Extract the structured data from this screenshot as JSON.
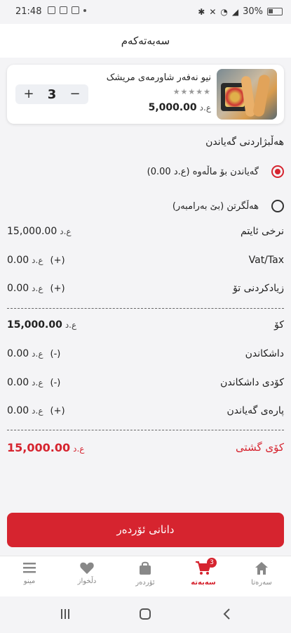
{
  "status_bar": {
    "time": "21:48",
    "battery": "30%"
  },
  "header": {
    "title": "سەبەتەکەم"
  },
  "cart_item": {
    "name": "نیو نەفەر شاورمەی مریشک",
    "stars": "★★★★★",
    "price": "5,000.00",
    "currency": "ع.د",
    "quantity": "3",
    "plus": "+",
    "minus": "−"
  },
  "delivery": {
    "title": "هەڵبژاردنی گەیاندن",
    "option_home": "گەیاندن بۆ ماڵەوە (ع.د 0.00)",
    "option_pickup": "هەڵگرتن (بێ بەرامبەر)",
    "selected": "home"
  },
  "summary": {
    "currency": "ع.د",
    "item_price": {
      "label": "نرخی ئایتم",
      "value": "15,000.00"
    },
    "vat": {
      "label": "Vat/Tax",
      "value": "0.00",
      "sign": "(+)"
    },
    "tip": {
      "label": "زیادکردنی تۆ",
      "value": "0.00",
      "sign": "(+)"
    },
    "subtotal": {
      "label": "کۆ",
      "value": "15,000.00"
    },
    "discount": {
      "label": "داشکاندن",
      "value": "0.00",
      "sign": "(-)"
    },
    "coupon": {
      "label": "کۆدی داشکاندن",
      "value": "0.00",
      "sign": "(-)"
    },
    "delivery_fee": {
      "label": "پارەی گەیاندن",
      "value": "0.00",
      "sign": "(+)"
    },
    "total": {
      "label": "کۆی گشتی",
      "value": "15,000.00"
    }
  },
  "cta": {
    "label": "دانانی ئۆردەر"
  },
  "bottom_nav": {
    "home": "سەرەتا",
    "cart": "سەبەتە",
    "cart_badge": "3",
    "orders": "ئۆردەر",
    "favorites": "دڵخواز",
    "menu": "مینو",
    "active": "cart"
  },
  "colors": {
    "accent": "#d6242f",
    "background": "#f4f4f6"
  }
}
